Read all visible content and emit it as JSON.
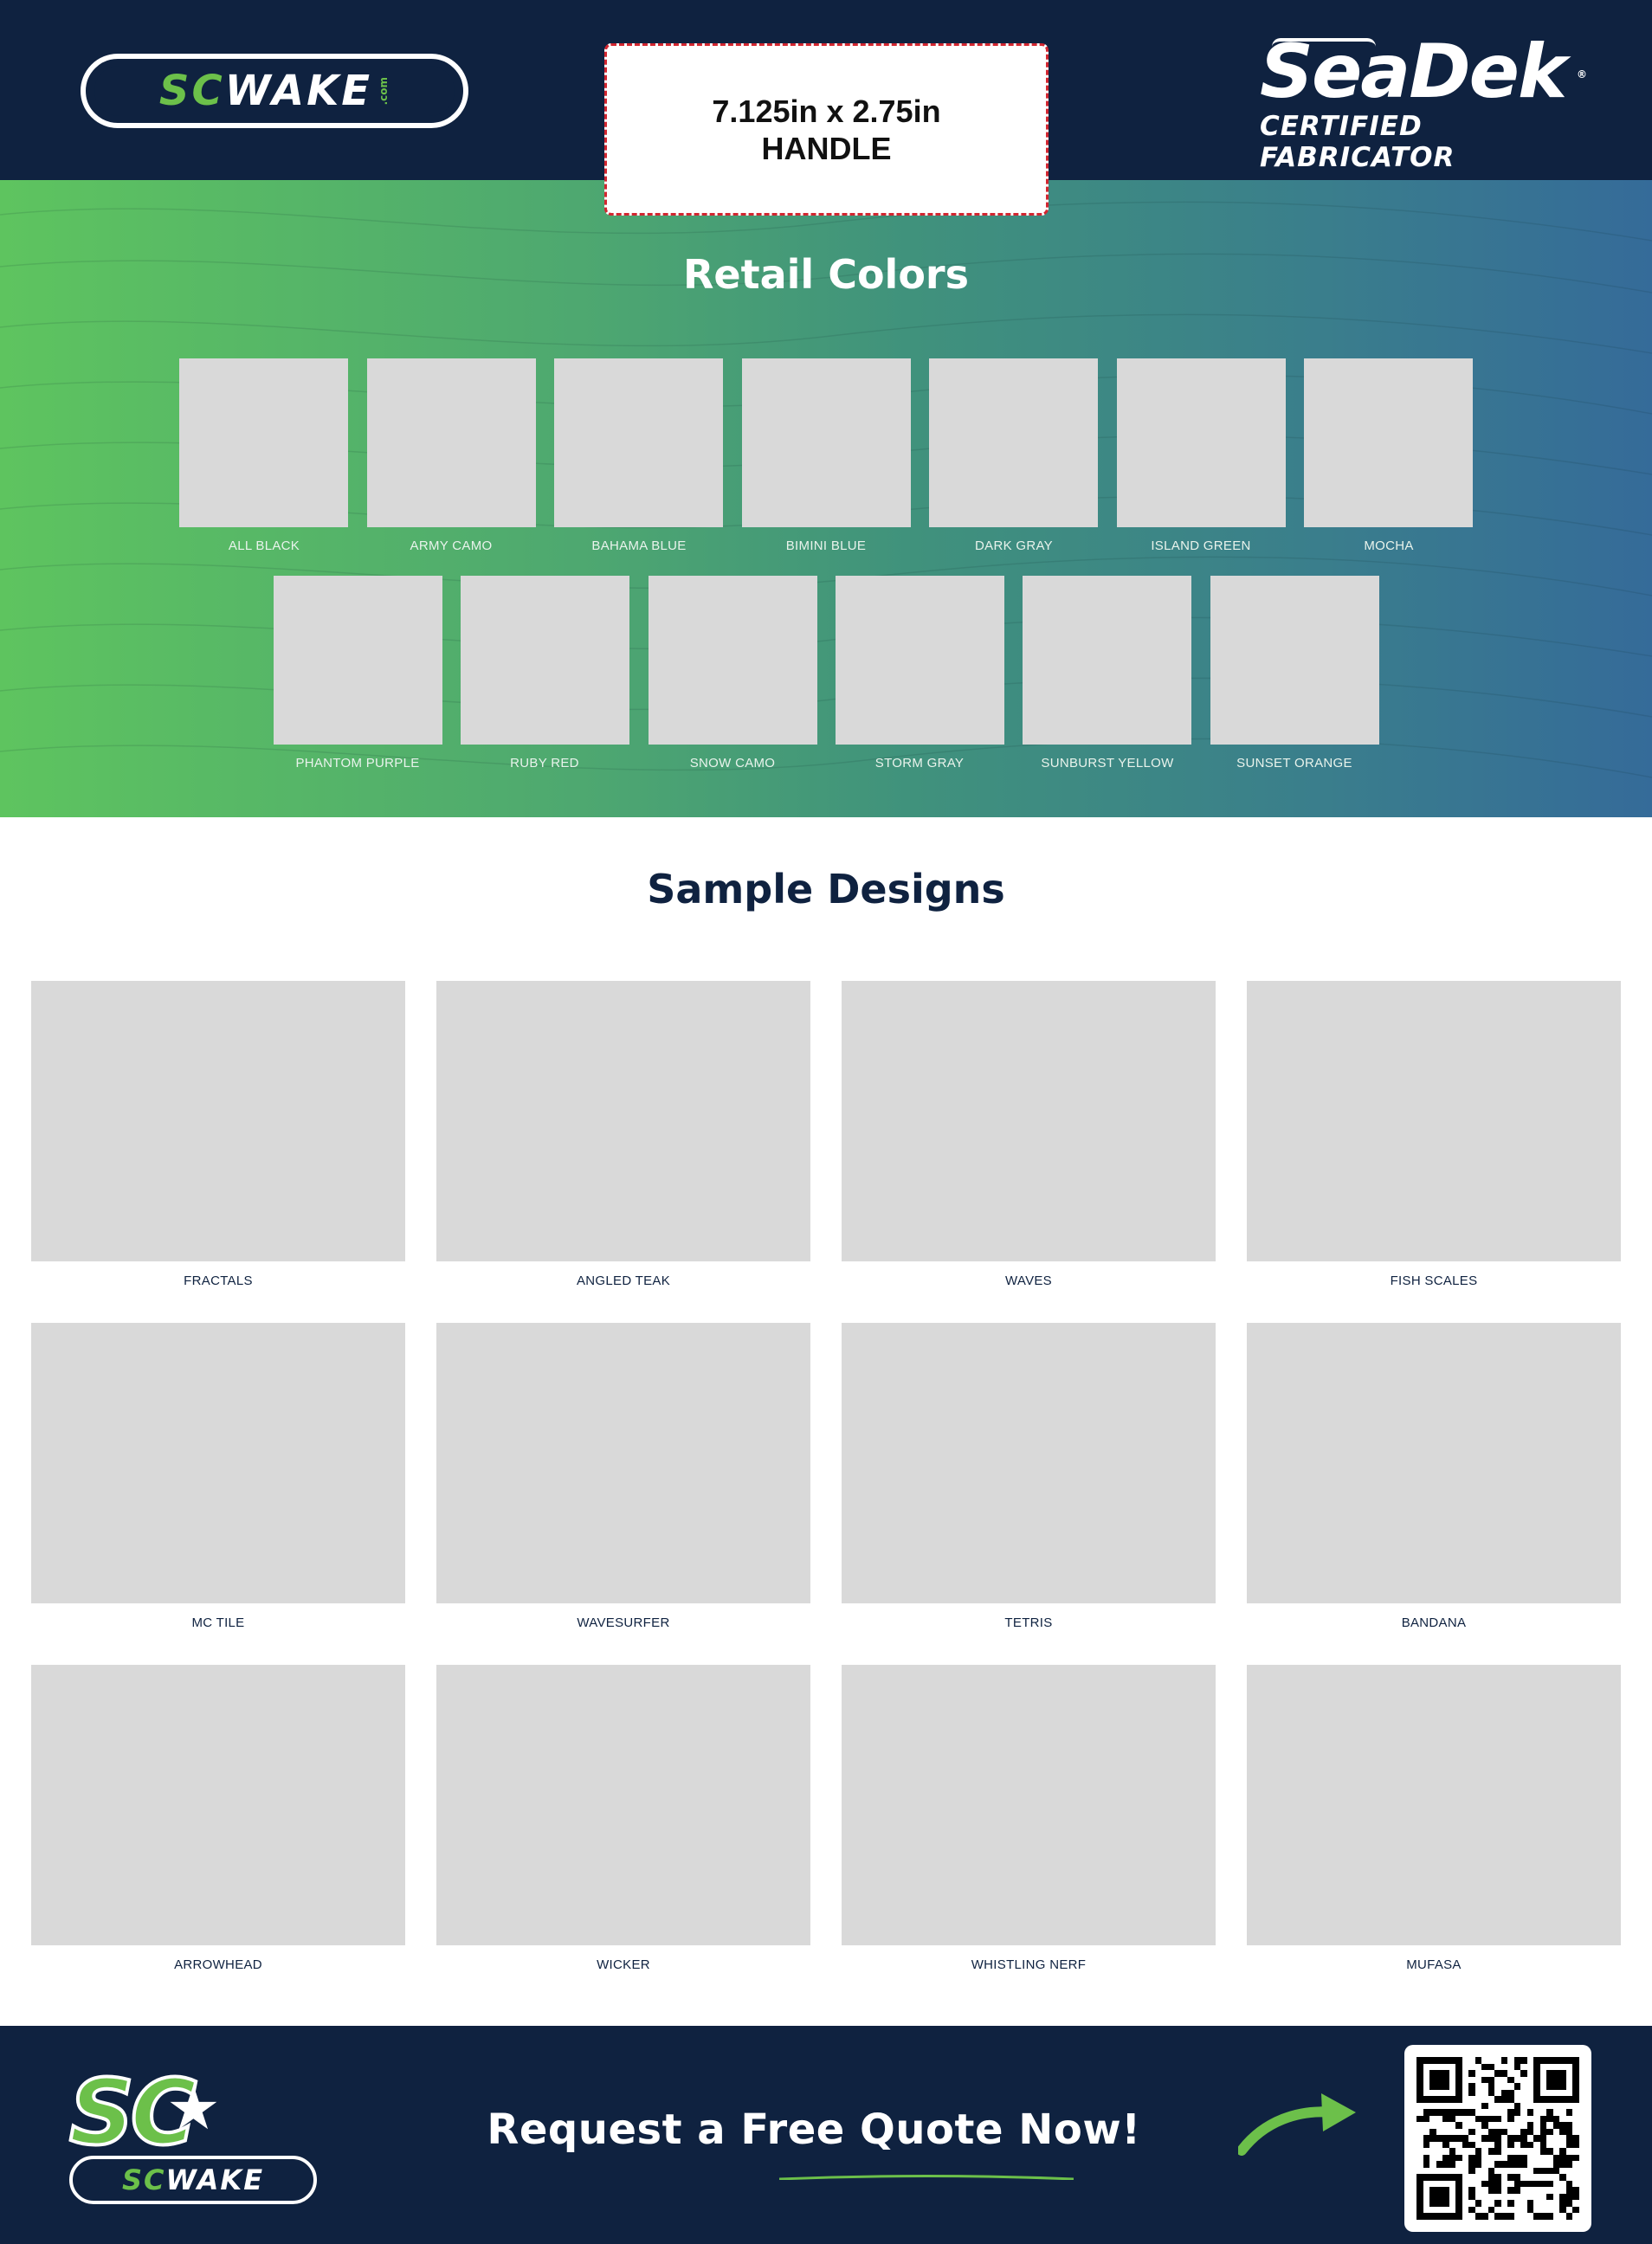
{
  "header": {
    "left_logo": {
      "sc": "SC",
      "wake": "WAKE",
      "dotcom": ".com"
    },
    "product_size": "7.125in x 2.75in",
    "product_name": "HANDLE",
    "right_logo": {
      "brand": "SeaDek",
      "registered": "®",
      "tagline": "CERTIFIED FABRICATOR"
    }
  },
  "retail": {
    "title": "Retail Colors",
    "row1": [
      "ALL BLACK",
      "ARMY CAMO",
      "BAHAMA BLUE",
      "BIMINI BLUE",
      "DARK GRAY",
      "ISLAND GREEN",
      "MOCHA"
    ],
    "row2": [
      "PHANTOM PURPLE",
      "RUBY RED",
      "SNOW CAMO",
      "STORM GRAY",
      "SUNBURST YELLOW",
      "SUNSET ORANGE"
    ]
  },
  "designs": {
    "title": "Sample Designs",
    "row1": [
      "FRACTALS",
      "ANGLED TEAK",
      "WAVES",
      "FISH SCALES"
    ],
    "row2": [
      "MC TILE",
      "WAVESURFER",
      "TETRIS",
      "BANDANA"
    ],
    "row3": [
      "ARROWHEAD",
      "WICKER",
      "WHISTLING NERF",
      "MUFASA"
    ]
  },
  "footer": {
    "logo": {
      "sc_big": "SC",
      "sc": "SC",
      "wake": "WAKE"
    },
    "cta": "Request a Free Quote Now!",
    "arrow_icon": "arrow-right-icon",
    "qr_icon": "qr-code-icon"
  },
  "colors": {
    "navy": "#0f2240",
    "green": "#6cc04a",
    "dashed_border": "#d22630",
    "placeholder": "#d9d9d9"
  }
}
